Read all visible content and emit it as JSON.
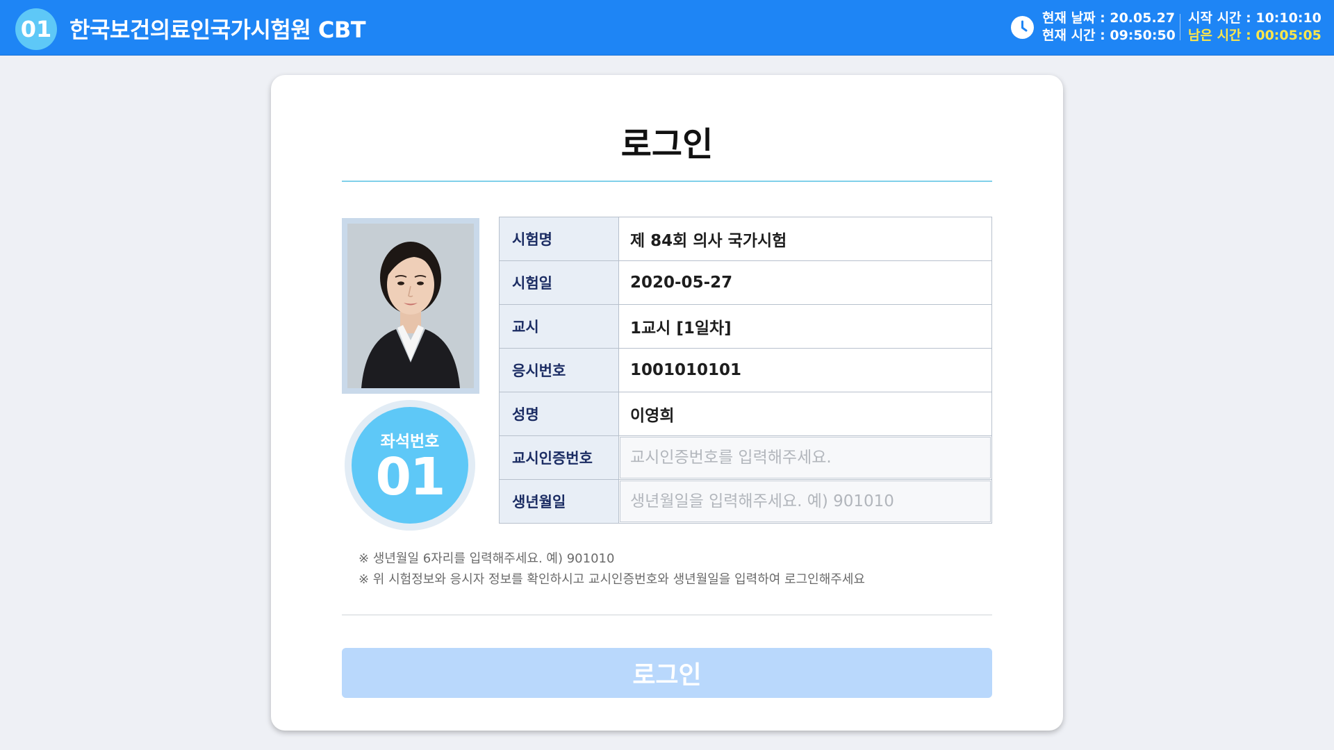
{
  "header": {
    "seat_no": "01",
    "title": "한국보건의료인국가시험원 CBT",
    "current_date_label": "현재 날짜 : 20.05.27",
    "current_time_label": "현재 시간 : 09:50:50",
    "start_time_label": "시작 시간 : 10:10:10",
    "remaining_time_label": "남은 시간 : 00:05:05",
    "clock_icon": "clock-icon",
    "colors": {
      "bar": "#1e85f5",
      "accent": "#5ec8f7",
      "remaining": "#ffe74a"
    }
  },
  "login": {
    "title": "로그인",
    "seat_badge_label": "좌석번호",
    "seat_badge_number": "01",
    "fields": [
      {
        "label": "시험명",
        "value": "제 84회 의사 국가시험"
      },
      {
        "label": "시험일",
        "value": "2020-05-27"
      },
      {
        "label": "교시",
        "value": "1교시 [1일차]"
      },
      {
        "label": "응시번호",
        "value": "1001010101"
      },
      {
        "label": "성명",
        "value": "이영희"
      }
    ],
    "cert_input": {
      "label": "교시인증번호",
      "placeholder": "교시인증번호를 입력해주세요."
    },
    "birth_input": {
      "label": "생년월일",
      "placeholder": "생년월일을 입력해주세요. 예) 901010"
    },
    "notes": [
      "※ 생년월일 6자리를 입력해주세요. 예) 901010",
      "※ 위 시험정보와 응시자 정보를 확인하시고 교시인증번호와 생년월일을 입력하여 로그인해주세요"
    ],
    "button_label": "로그인",
    "colors": {
      "button": "#b9d8fc",
      "rule": "#7fd0e9"
    }
  }
}
